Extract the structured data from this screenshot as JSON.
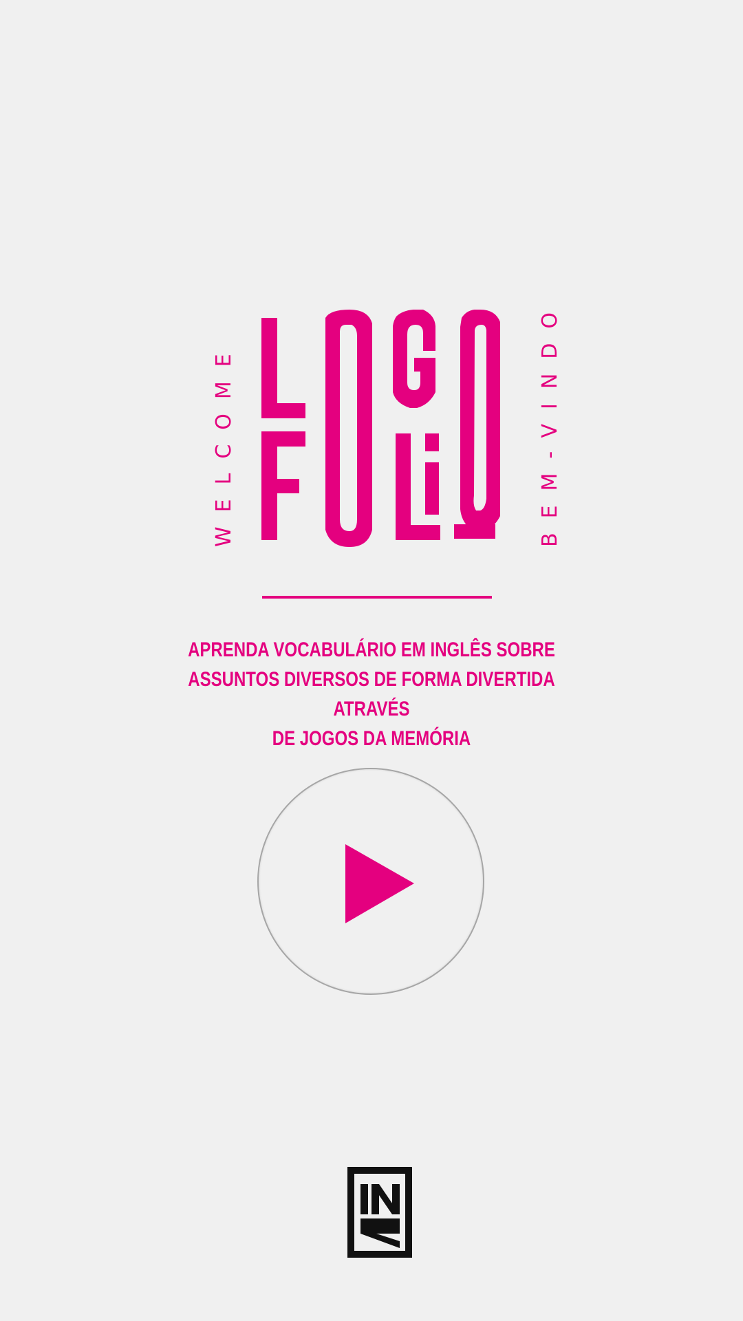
{
  "logo": {
    "title": "LOGO FOLIO",
    "welcome": "WELCOME",
    "bem_vindo": "BEM-VINDO"
  },
  "tagline": {
    "line1": "APRENDA VOCABULÁRIO EM INGLÊS SOBRE",
    "line2": "ASSUNTOS DIVERSOS DE FORMA DIVERTIDA ATRAVÉS",
    "line3": "DE JOGOS DA MEMÓRIA"
  },
  "play_button": {
    "icon": "play-icon"
  },
  "brand": {
    "text": "INK",
    "icon": "ink-logo"
  },
  "colors": {
    "accent": "#e4007f",
    "background": "#f0f0f0",
    "brand": "#111111"
  }
}
